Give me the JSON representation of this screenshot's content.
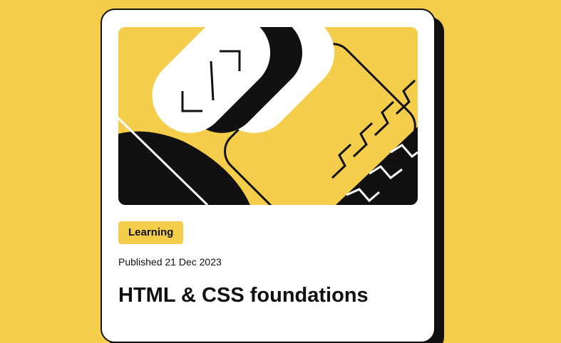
{
  "colors": {
    "background": "#F4CE4B",
    "card": "#FFFFFF",
    "ink": "#111111",
    "badge": "#F4CE4B"
  },
  "card": {
    "illustration_icon": "code-illustration",
    "category": "Learning",
    "published": "Published 21 Dec 2023",
    "title": "HTML & CSS foundations"
  }
}
